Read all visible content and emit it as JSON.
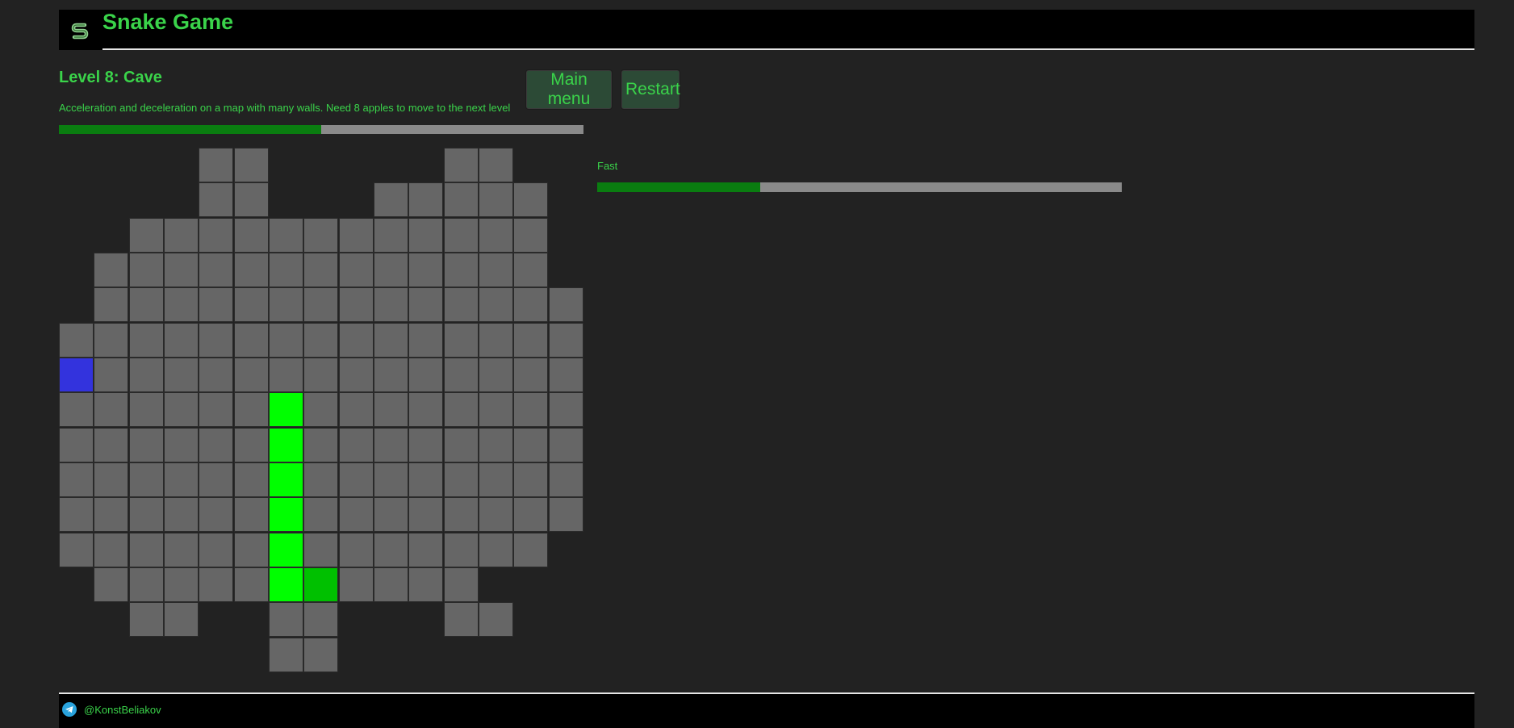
{
  "header": {
    "title": "Snake Game",
    "logo_icon": "snake-logo-icon"
  },
  "level": {
    "title": "Level 8: Cave",
    "description": "Acceleration and deceleration on a map with many walls. Need 8 apples to move to the next level",
    "progress": 0.5
  },
  "buttons": {
    "main_menu": "Main menu",
    "restart": "Restart"
  },
  "speed": {
    "label": "Fast",
    "value": 0.31
  },
  "board": {
    "cols": 15,
    "rows": 15,
    "map": [
      "....##.....##..",
      "....##...#####.",
      "..############.",
      ".#############.",
      ".##############",
      "###############",
      "###############",
      "###############",
      "###############",
      "###############",
      "###############",
      "##############.",
      ".###########...",
      "..##..##...##..",
      "......##......."
    ],
    "snake": [
      [
        7,
        6
      ],
      [
        8,
        6
      ],
      [
        9,
        6
      ],
      [
        10,
        6
      ],
      [
        11,
        6
      ],
      [
        12,
        6
      ],
      [
        12,
        7
      ]
    ],
    "snake_head": [
      12,
      7
    ],
    "apple": [
      6,
      0
    ]
  },
  "colors": {
    "accent": "#3ad34a",
    "cell": "#666666",
    "snake": "#00ff00",
    "snake_head": "#00c000",
    "apple": "#3333dd",
    "progress_fill": "#0a7d10",
    "progress_track": "#8a8a8a"
  },
  "footer": {
    "handle": "@KonstBeliakov",
    "icon": "telegram-icon"
  }
}
